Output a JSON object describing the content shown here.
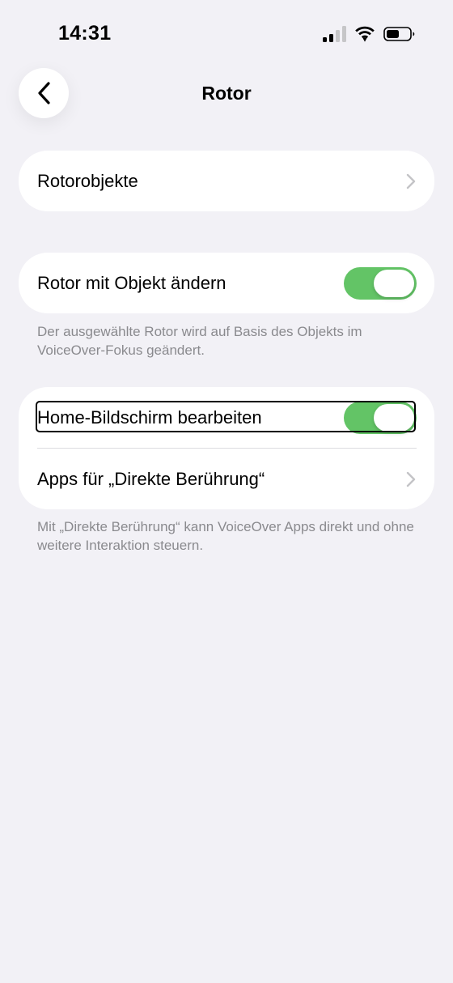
{
  "status_bar": {
    "time": "14:31",
    "icons": [
      "cellular-signal-icon",
      "wifi-icon",
      "battery-icon"
    ]
  },
  "nav": {
    "title": "Rotor",
    "back_icon": "chevron-left-icon"
  },
  "groups": [
    {
      "rows": [
        {
          "label": "Rotorobjekte",
          "accessory": "chevron-right-icon"
        }
      ]
    },
    {
      "rows": [
        {
          "label": "Rotor mit Objekt ändern",
          "toggle_on": true
        }
      ],
      "footer": "Der ausgewählte Rotor wird auf Basis des Objekts im VoiceOver-Fokus geändert."
    },
    {
      "rows": [
        {
          "label": "Home-Bildschirm bearbeiten",
          "toggle_on": true,
          "voiceover_focused": true
        },
        {
          "label": "Apps für „Direkte Berührung“",
          "accessory": "chevron-right-icon"
        }
      ],
      "footer": "Mit „Direkte Berührung“ kann VoiceOver Apps direkt und ohne weitere Interaktion steuern."
    }
  ],
  "colors": {
    "background": "#f2f1f6",
    "toggle_on": "#63c466",
    "footnote_text": "#8a8a8e",
    "chevron": "#c4c4c7"
  }
}
